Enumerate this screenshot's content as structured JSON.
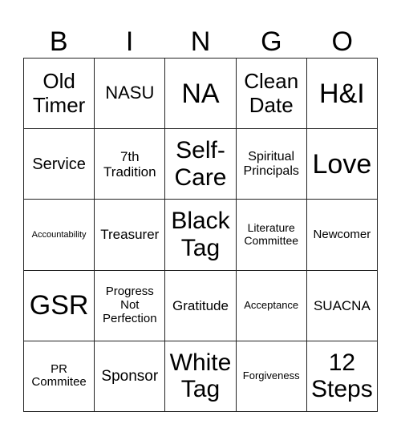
{
  "header": [
    "B",
    "I",
    "N",
    "G",
    "O"
  ],
  "cells": [
    {
      "text": "Old Timer",
      "size": 26
    },
    {
      "text": "NASU",
      "size": 22
    },
    {
      "text": "NA",
      "size": 34
    },
    {
      "text": "Clean Date",
      "size": 26
    },
    {
      "text": "H&I",
      "size": 34
    },
    {
      "text": "Service",
      "size": 20
    },
    {
      "text": "7th Tradition",
      "size": 17
    },
    {
      "text": "Self-Care",
      "size": 30
    },
    {
      "text": "Spiritual Principals",
      "size": 16
    },
    {
      "text": "Love",
      "size": 34
    },
    {
      "text": "Accountability",
      "size": 11
    },
    {
      "text": "Treasurer",
      "size": 17
    },
    {
      "text": "Black Tag",
      "size": 30
    },
    {
      "text": "Literature Committee",
      "size": 14
    },
    {
      "text": "Newcomer",
      "size": 15
    },
    {
      "text": "GSR",
      "size": 34
    },
    {
      "text": "Progress Not Perfection",
      "size": 15
    },
    {
      "text": "Gratitude",
      "size": 17
    },
    {
      "text": "Acceptance",
      "size": 13
    },
    {
      "text": "SUACNA",
      "size": 17
    },
    {
      "text": "PR Commitee",
      "size": 15
    },
    {
      "text": "Sponsor",
      "size": 19
    },
    {
      "text": "White Tag",
      "size": 30
    },
    {
      "text": "Forgiveness",
      "size": 13
    },
    {
      "text": "12 Steps",
      "size": 30
    }
  ]
}
